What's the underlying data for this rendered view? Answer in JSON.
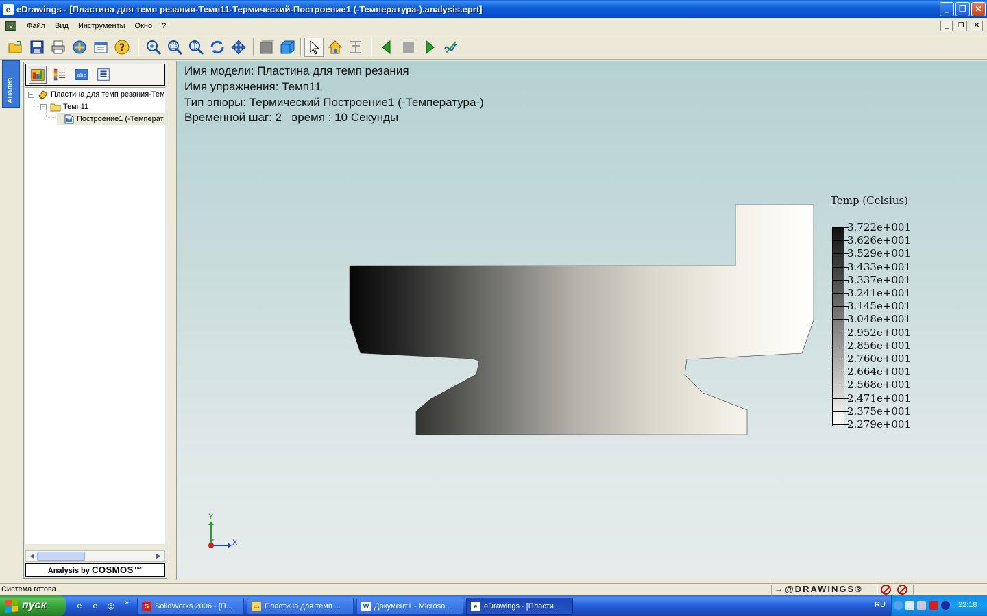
{
  "window": {
    "title": "eDrawings - [Пластина для темп резания-Темп11-Термический-Построение1 (-Температура-).analysis.eprt]",
    "app_icon": "edrawings-icon",
    "controls": [
      "_",
      "❐",
      "✕"
    ]
  },
  "menu": {
    "items": [
      "Файл",
      "Вид",
      "Инструменты",
      "Окно",
      "?"
    ]
  },
  "toolbar": {
    "buttons": [
      "open-icon",
      "save-icon",
      "print-icon",
      "send-icon",
      "publish-icon",
      "help-icon",
      "zoom-to-fit-icon",
      "zoom-to-area-icon",
      "zoom-in-out-icon",
      "rotate-icon",
      "pan-icon",
      "shaded-icon",
      "3d-pointer-icon",
      "select-icon",
      "home-icon",
      "explode-icon",
      "previous-icon",
      "stop-icon",
      "play-icon",
      "animate-icon"
    ]
  },
  "sidebar": {
    "tab_label": "Анализ",
    "tree": [
      {
        "label": "Пластина для темп резания-Тем",
        "level": 0,
        "expander": "−"
      },
      {
        "label": "Темп11",
        "level": 1,
        "expander": "−"
      },
      {
        "label": "Построение1 (-Температ",
        "level": 2,
        "expander": ""
      }
    ],
    "footer_prefix": "Analysis by",
    "footer_brand": "COSMOS™"
  },
  "viewport": {
    "info": [
      "Имя модели: Пластина для темп резания",
      "Имя упражнения: Темп11",
      "Тип эпюры: Термический Построение1 (-Температура-)",
      "Временной шаг: 2   время : 10 Секунды"
    ],
    "legend_title": "Temp (Celsius)",
    "legend_values": [
      "3.722e+001",
      "3.626e+001",
      "3.529e+001",
      "3.433e+001",
      "3.337e+001",
      "3.241e+001",
      "3.145e+001",
      "3.048e+001",
      "2.952e+001",
      "2.856e+001",
      "2.760e+001",
      "2.664e+001",
      "2.568e+001",
      "2.471e+001",
      "2.375e+001",
      "2.279e+001"
    ],
    "axis_y": "Y",
    "axis_x": "X"
  },
  "status": {
    "text": "Система готова",
    "brand": "→@DRAWINGS®"
  },
  "taskbar": {
    "start_label": "пуск",
    "tasks": [
      {
        "label": "SolidWorks 2006 - [П...",
        "icon": "solidworks-icon",
        "active": false
      },
      {
        "label": "Пластина для темп ...",
        "icon": "folder-icon",
        "active": false
      },
      {
        "label": "Документ1 - Microso...",
        "icon": "word-icon",
        "active": false
      },
      {
        "label": "eDrawings - [Пласти...",
        "icon": "edrawings-icon",
        "active": true
      }
    ],
    "language": "RU",
    "clock": "22:18"
  },
  "colors": {
    "titlebar": "#0b5ad6",
    "viewport_top": "#b4d1d2",
    "viewport_bottom": "#e6ecec",
    "accent_blue": "#2f6fe0",
    "start_green": "#35a335"
  }
}
